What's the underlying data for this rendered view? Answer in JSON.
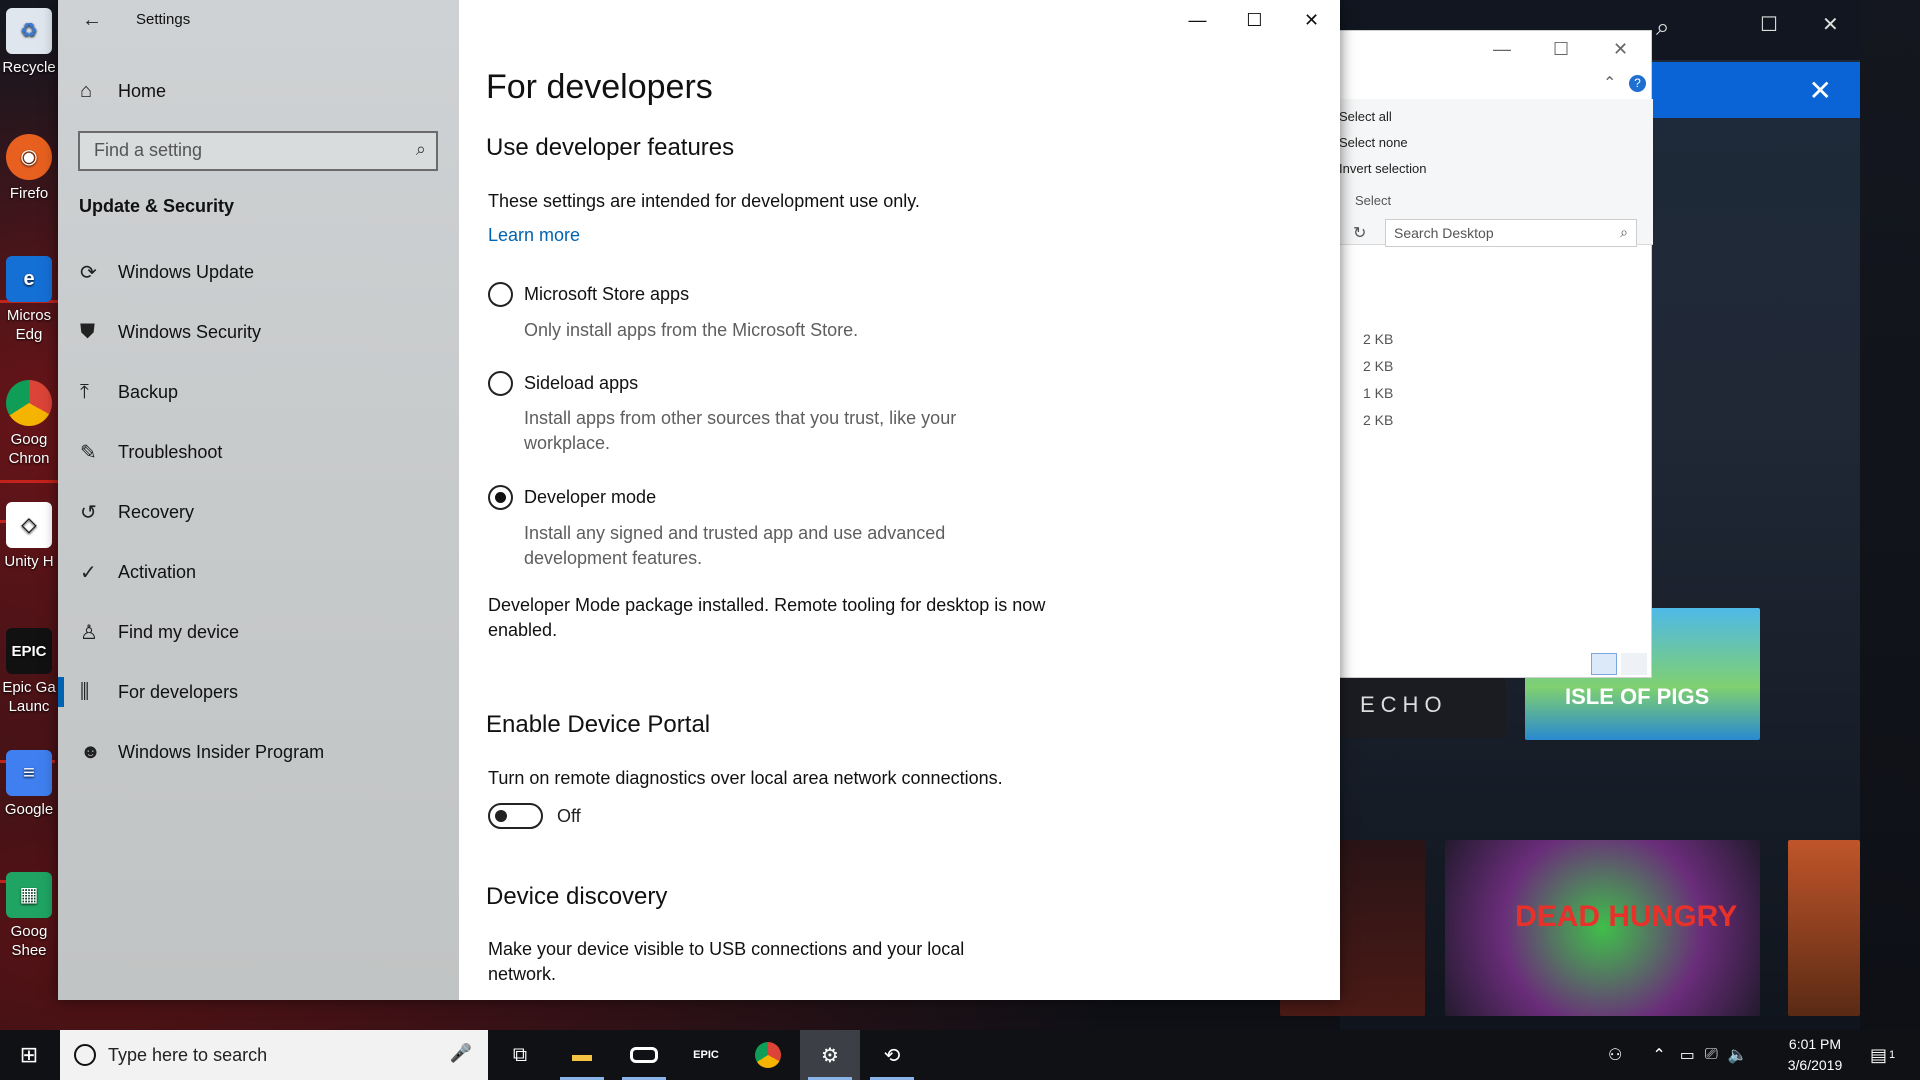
{
  "window": {
    "title": "Settings",
    "controls": {
      "minimize": "—",
      "maximize": "☐",
      "close": "✕"
    }
  },
  "sidebar": {
    "back_icon": "back-arrow-icon",
    "home_label": "Home",
    "search_placeholder": "Find a setting",
    "section_title": "Update & Security",
    "items": [
      {
        "label": "Windows Update",
        "icon": "sync-icon"
      },
      {
        "label": "Windows Security",
        "icon": "shield-icon"
      },
      {
        "label": "Backup",
        "icon": "upload-arrow-icon"
      },
      {
        "label": "Troubleshoot",
        "icon": "wrench-icon"
      },
      {
        "label": "Recovery",
        "icon": "history-icon"
      },
      {
        "label": "Activation",
        "icon": "checkmark-circle-icon"
      },
      {
        "label": "Find my device",
        "icon": "person-pin-icon"
      },
      {
        "label": "For developers",
        "icon": "developer-sliders-icon",
        "active": true
      },
      {
        "label": "Windows Insider Program",
        "icon": "cat-icon"
      }
    ]
  },
  "main": {
    "page_title": "For developers",
    "dev_features": {
      "heading": "Use developer features",
      "intro": "These settings are intended for development use only.",
      "learn_more": "Learn more",
      "options": [
        {
          "label": "Microsoft Store apps",
          "desc": "Only install apps from the Microsoft Store.",
          "checked": false
        },
        {
          "label": "Sideload apps",
          "desc": "Install apps from other sources that you trust, like your workplace.",
          "checked": false
        },
        {
          "label": "Developer mode",
          "desc": "Install any signed and trusted app and use advanced development features.",
          "checked": true
        }
      ],
      "status": "Developer Mode package installed.  Remote tooling for desktop is now enabled."
    },
    "device_portal": {
      "heading": "Enable Device Portal",
      "desc": "Turn on remote diagnostics over local area network connections.",
      "toggle_state": "Off"
    },
    "device_discovery": {
      "heading": "Device discovery",
      "desc": "Make your device visible to USB connections and your local network."
    }
  },
  "explorer": {
    "ribbon_items": [
      "Select all",
      "Select none",
      "Invert selection"
    ],
    "group_label": "Select",
    "search_placeholder": "Search Desktop",
    "sizes": [
      "2 KB",
      "2 KB",
      "1 KB",
      "2 KB"
    ]
  },
  "background_app": {
    "tile_texts": [
      "ECHO",
      "ISLE OF PIGS",
      "DEAD HUNGRY"
    ]
  },
  "desktop_icons": [
    "Recycle",
    "Firefo",
    "Micros Edg",
    "Goog Chron",
    "Unity H",
    "Epic Ga Launc",
    "Google",
    "Goog Shee"
  ],
  "taskbar": {
    "search_placeholder": "Type here to search",
    "apps": [
      "task-view-icon",
      "file-explorer-icon",
      "oculus-icon",
      "epic-games-icon",
      "chrome-icon",
      "settings-gear-icon",
      "sync-app-icon"
    ],
    "epic_label": "EPIC",
    "clock_time": "6:01 PM",
    "clock_date": "3/6/2019",
    "notification_count": "1"
  },
  "colors": {
    "accent": "#0063b1",
    "link": "#0063b1",
    "store_blue": "#0a64d6"
  }
}
